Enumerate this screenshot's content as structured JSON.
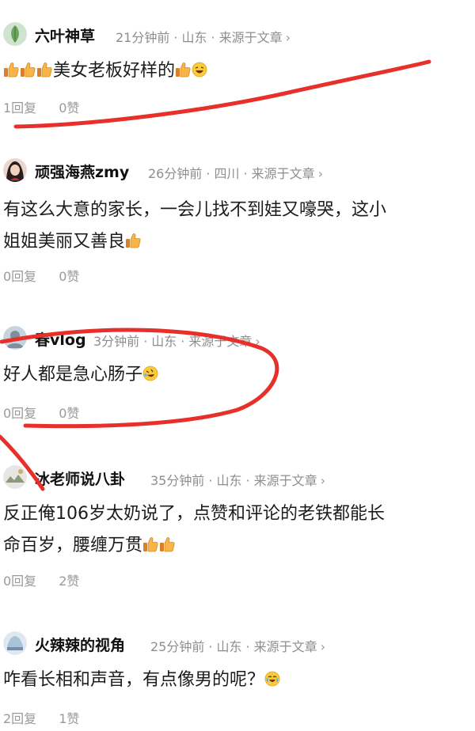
{
  "comments": [
    {
      "username": "六叶神草",
      "time": "21分钟前",
      "location": "山东",
      "source": "来源于文章",
      "chevron": "›",
      "text_after_emoji": "美女老板好样的",
      "replies": "1回复",
      "likes": "0赞",
      "emoji_before": [
        "thumbs-up-icon",
        "thumbs-up-icon",
        "thumbs-up-icon"
      ],
      "emoji_after": [
        "thumbs-up-icon",
        "laughing-face-icon"
      ]
    },
    {
      "username": "顽强海燕zmy",
      "time": "26分钟前",
      "location": "四川",
      "source": "来源于文章",
      "chevron": "›",
      "text_line1": "有这么大意的家长，一会儿找不到娃又嚎哭，这小",
      "text_line2": "姐姐美丽又善良",
      "replies": "0回复",
      "likes": "0赞",
      "emoji_after": [
        "thumbs-up-icon"
      ]
    },
    {
      "username": "春vlog",
      "time": "3分钟前",
      "location": "山东",
      "source": "来源于文章",
      "chevron": "›",
      "text": "好人都是急心肠子",
      "replies": "0回复",
      "likes": "0赞",
      "emoji_after": [
        "rolling-laughing-icon"
      ]
    },
    {
      "username": "冰老师说八卦",
      "time": "35分钟前",
      "location": "山东",
      "source": "来源于文章",
      "chevron": "›",
      "text_line1": "反正俺106岁太奶说了，点赞和评论的老铁都能长",
      "text_line2": "命百岁，腰缠万贯",
      "replies": "0回复",
      "likes": "2赞",
      "emoji_after": [
        "thumbs-up-icon",
        "thumbs-up-icon"
      ]
    },
    {
      "username": "火辣辣的视角",
      "time": "25分钟前",
      "location": "山东",
      "source": "来源于文章",
      "chevron": "›",
      "text": "咋看长相和声音，有点像男的呢？",
      "replies": "2回复",
      "likes": "1赞",
      "emoji_after": [
        "crying-laughing-icon"
      ]
    }
  ],
  "colors": {
    "annotation_red": "#e8302a",
    "meta_gray": "#8e8e8e",
    "thumb_yellow": "#f5b642"
  }
}
